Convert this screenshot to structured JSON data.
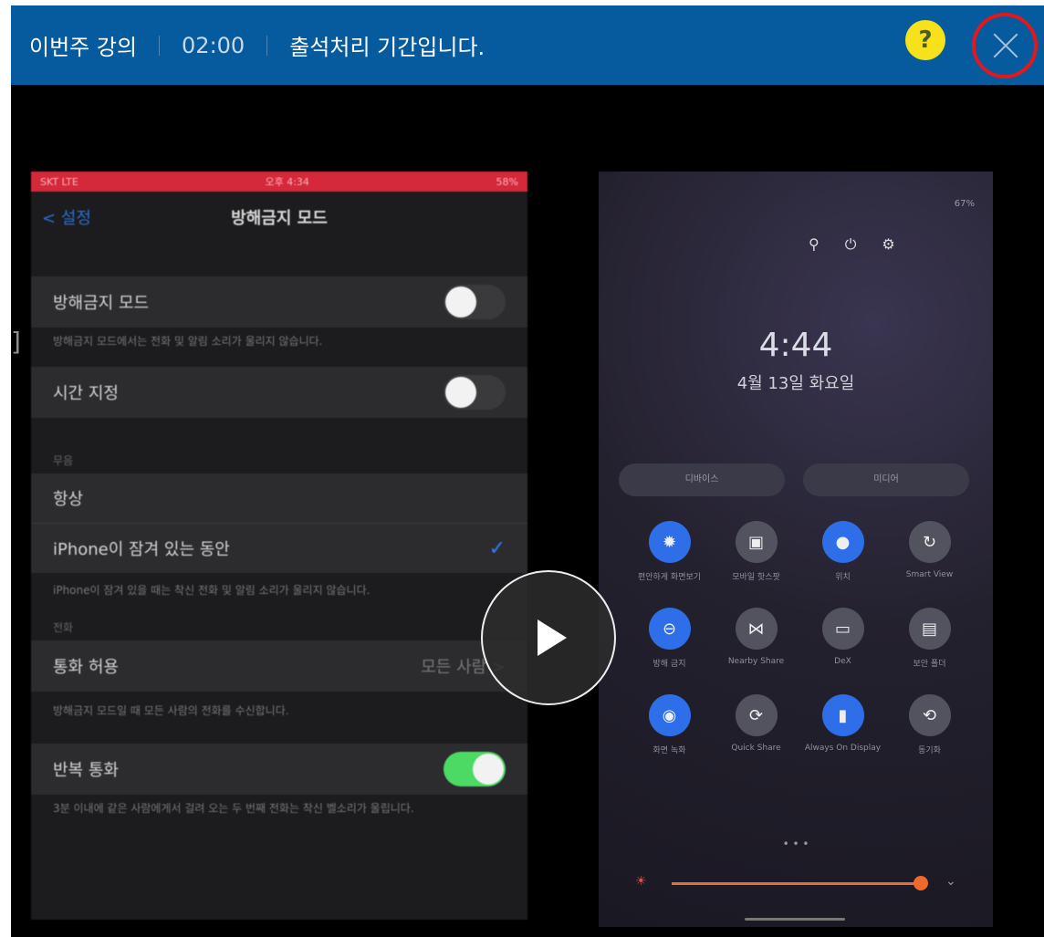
{
  "header": {
    "title": "이번주 강의",
    "time": "02:00",
    "message": "출석처리 기간입니다.",
    "help": "?"
  },
  "video": {
    "left_bracket": "]",
    "iphone": {
      "status_left": "SKT LTE",
      "status_center": "오후 4:34",
      "status_right": "58%",
      "back": "< 설정",
      "title": "방해금지 모드",
      "dnd_label": "방해금지 모드",
      "dnd_note": "방해금지 모드에서는 전화 및 알림 소리가 울리지 않습니다.",
      "schedule_label": "시간 지정",
      "silence_section": "무음",
      "always_label": "항상",
      "locked_label": "iPhone이 잠겨 있는 동안",
      "locked_note": "iPhone이 잠겨 있을 때는 착신 전화 및 알림 소리가 울리지 않습니다.",
      "phone_section": "전화",
      "allow_calls_label": "통화 허용",
      "allow_calls_value": "모든 사람 >",
      "allow_calls_note": "방해금지 모드일 때 모든 사람의 전화를 수신합니다.",
      "repeat_label": "반복 통화",
      "repeat_note": "3분 이내에 같은 사람에게서 걸려 오는 두 번째 전화는 착신 벨소리가 울립니다."
    },
    "android": {
      "status": "67%",
      "clock": "4:44",
      "date": "4월 13일 화요일",
      "pill_left": "디바이스",
      "pill_right": "미디어",
      "tiles": [
        {
          "label": "편안하게 화면보기",
          "on": true
        },
        {
          "label": "모바일 핫스팟",
          "on": false
        },
        {
          "label": "위치",
          "on": true
        },
        {
          "label": "Smart View",
          "on": false
        },
        {
          "label": "방해 금지",
          "on": true
        },
        {
          "label": "Nearby Share",
          "on": false
        },
        {
          "label": "DeX",
          "on": false
        },
        {
          "label": "보안 폴더",
          "on": false
        },
        {
          "label": "화면 녹화",
          "on": true
        },
        {
          "label": "Quick Share",
          "on": false
        },
        {
          "label": "Always On Display",
          "on": true
        },
        {
          "label": "동기화",
          "on": false
        }
      ]
    }
  },
  "colors": {
    "header_bg": "#055b9d",
    "help_bg": "#f6e11b",
    "close_ring": "#e2181d",
    "toggle_on": "#4cd964"
  },
  "icons": [
    "help-icon",
    "close-icon",
    "play-icon",
    "check-icon",
    "search-icon",
    "power-icon",
    "gear-icon"
  ]
}
